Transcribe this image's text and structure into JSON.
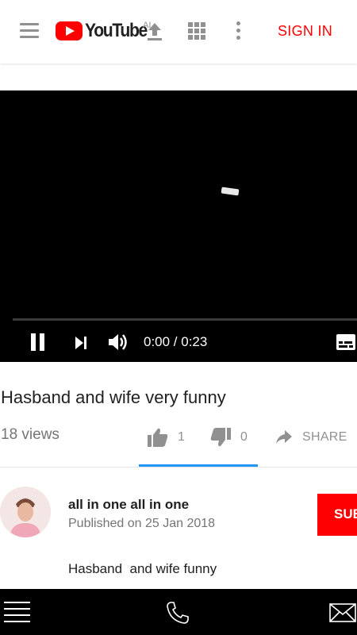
{
  "header": {
    "logo_text": "YouTube",
    "logo_badge": "AI",
    "signin_label": "SIGN IN",
    "brand_color": "#ff0000",
    "icons": [
      "menu-icon",
      "youtube-logo",
      "upload-icon",
      "apps-icon",
      "more-vert-icon"
    ]
  },
  "player": {
    "time_display": "0:00 / 0:23",
    "progress": 0,
    "controls": [
      "pause-icon",
      "next-icon",
      "volume-icon",
      "captions-icon"
    ]
  },
  "video": {
    "title": "Hasband and wife very funny",
    "views": "18 views",
    "likes": "1",
    "dislikes": "0",
    "share_label": "SHARE",
    "accent_color": "#2196f3"
  },
  "channel": {
    "name": "all in one all in one",
    "published": "Published on 25 Jan 2018",
    "subscribe_label": "SUBSCRIBE",
    "description": "Hasband  and wife funny"
  },
  "bottom_bar": {
    "icons": [
      "hamburger-menu-icon",
      "phone-icon",
      "mail-icon"
    ]
  }
}
